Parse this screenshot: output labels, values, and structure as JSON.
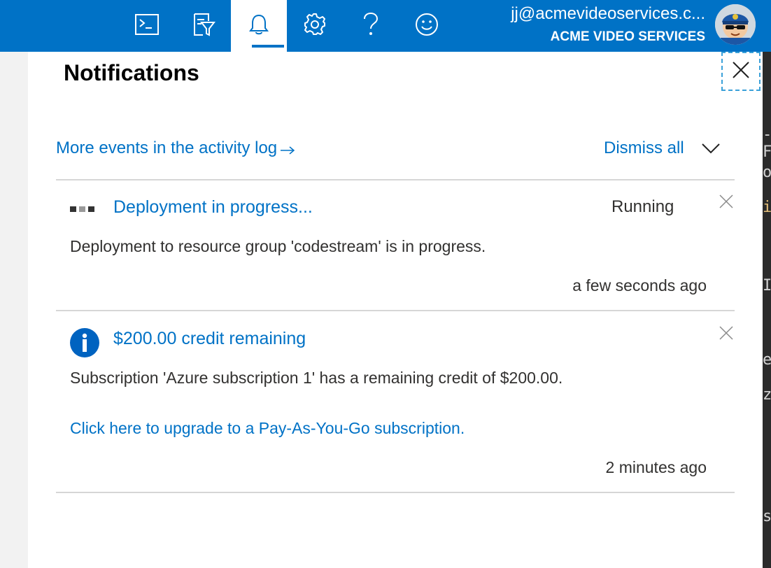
{
  "topbar": {
    "icons": [
      "terminal-icon",
      "directory-filter-icon",
      "bell-icon",
      "gear-icon",
      "help-icon",
      "smiley-icon"
    ],
    "user_email": "jj@acmevideoservices.c...",
    "user_org": "ACME VIDEO SERVICES",
    "accent_color": "#0072c6"
  },
  "panel": {
    "title": "Notifications",
    "activity_link": "More events in the activity log",
    "dismiss_all": "Dismiss all"
  },
  "notifications": [
    {
      "title": "Deployment in progress...",
      "status": "Running",
      "body": "Deployment to resource group 'codestream' is in progress.",
      "time": "a few seconds ago",
      "icon": "progress-dots-icon"
    },
    {
      "title": "$200.00 credit remaining",
      "body": "Subscription 'Azure subscription 1' has a remaining credit of $200.00.",
      "link": "Click here to upgrade to a Pay-As-You-Go subscription.",
      "time": "2 minutes ago",
      "icon": "info-icon"
    }
  ],
  "background_fragments": [
    "-F",
    "o",
    "i",
    "I",
    "e",
    "zu",
    "st"
  ]
}
